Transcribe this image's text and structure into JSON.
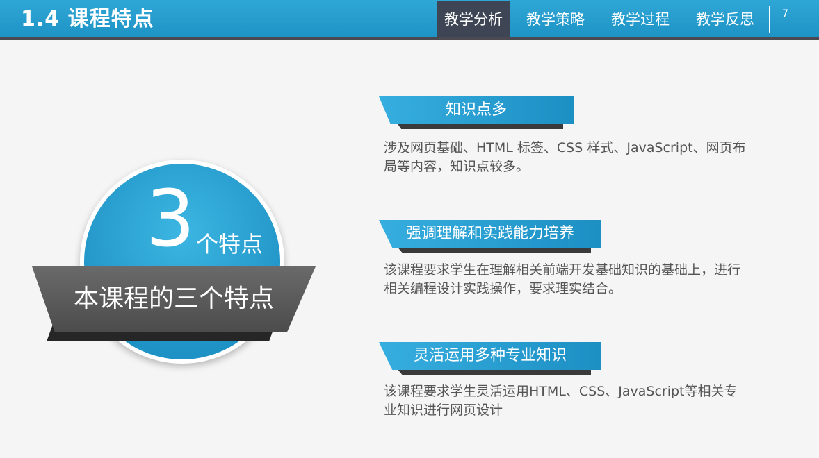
{
  "header": {
    "title": "1.4 课程特点",
    "tabs": [
      {
        "label": "教学分析",
        "active": true
      },
      {
        "label": "教学策略",
        "active": false
      },
      {
        "label": "教学过程",
        "active": false
      },
      {
        "label": "教学反思",
        "active": false
      }
    ],
    "page_number": "7"
  },
  "infographic": {
    "number": "3",
    "suffix": "个特点",
    "ribbon_label": "本课程的三个特点"
  },
  "features": [
    {
      "title": "知识点多",
      "description": "涉及网页基础、HTML 标签、CSS 样式、JavaScript、网页布局等内容，知识点较多。"
    },
    {
      "title": "强调理解和实践能力培养",
      "description": "该课程要求学生在理解相关前端开发基础知识的基础上，进行相关编程设计实践操作，要求理实结合。"
    },
    {
      "title": "灵活运用多种专业知识",
      "description": "该课程要求学生灵活运用HTML、CSS、JavaScript等相关专业知识进行网页设计"
    }
  ],
  "colors": {
    "accent": "#1e93c6",
    "active_tab": "#3e4656",
    "ribbon": "#5a5a5a"
  }
}
